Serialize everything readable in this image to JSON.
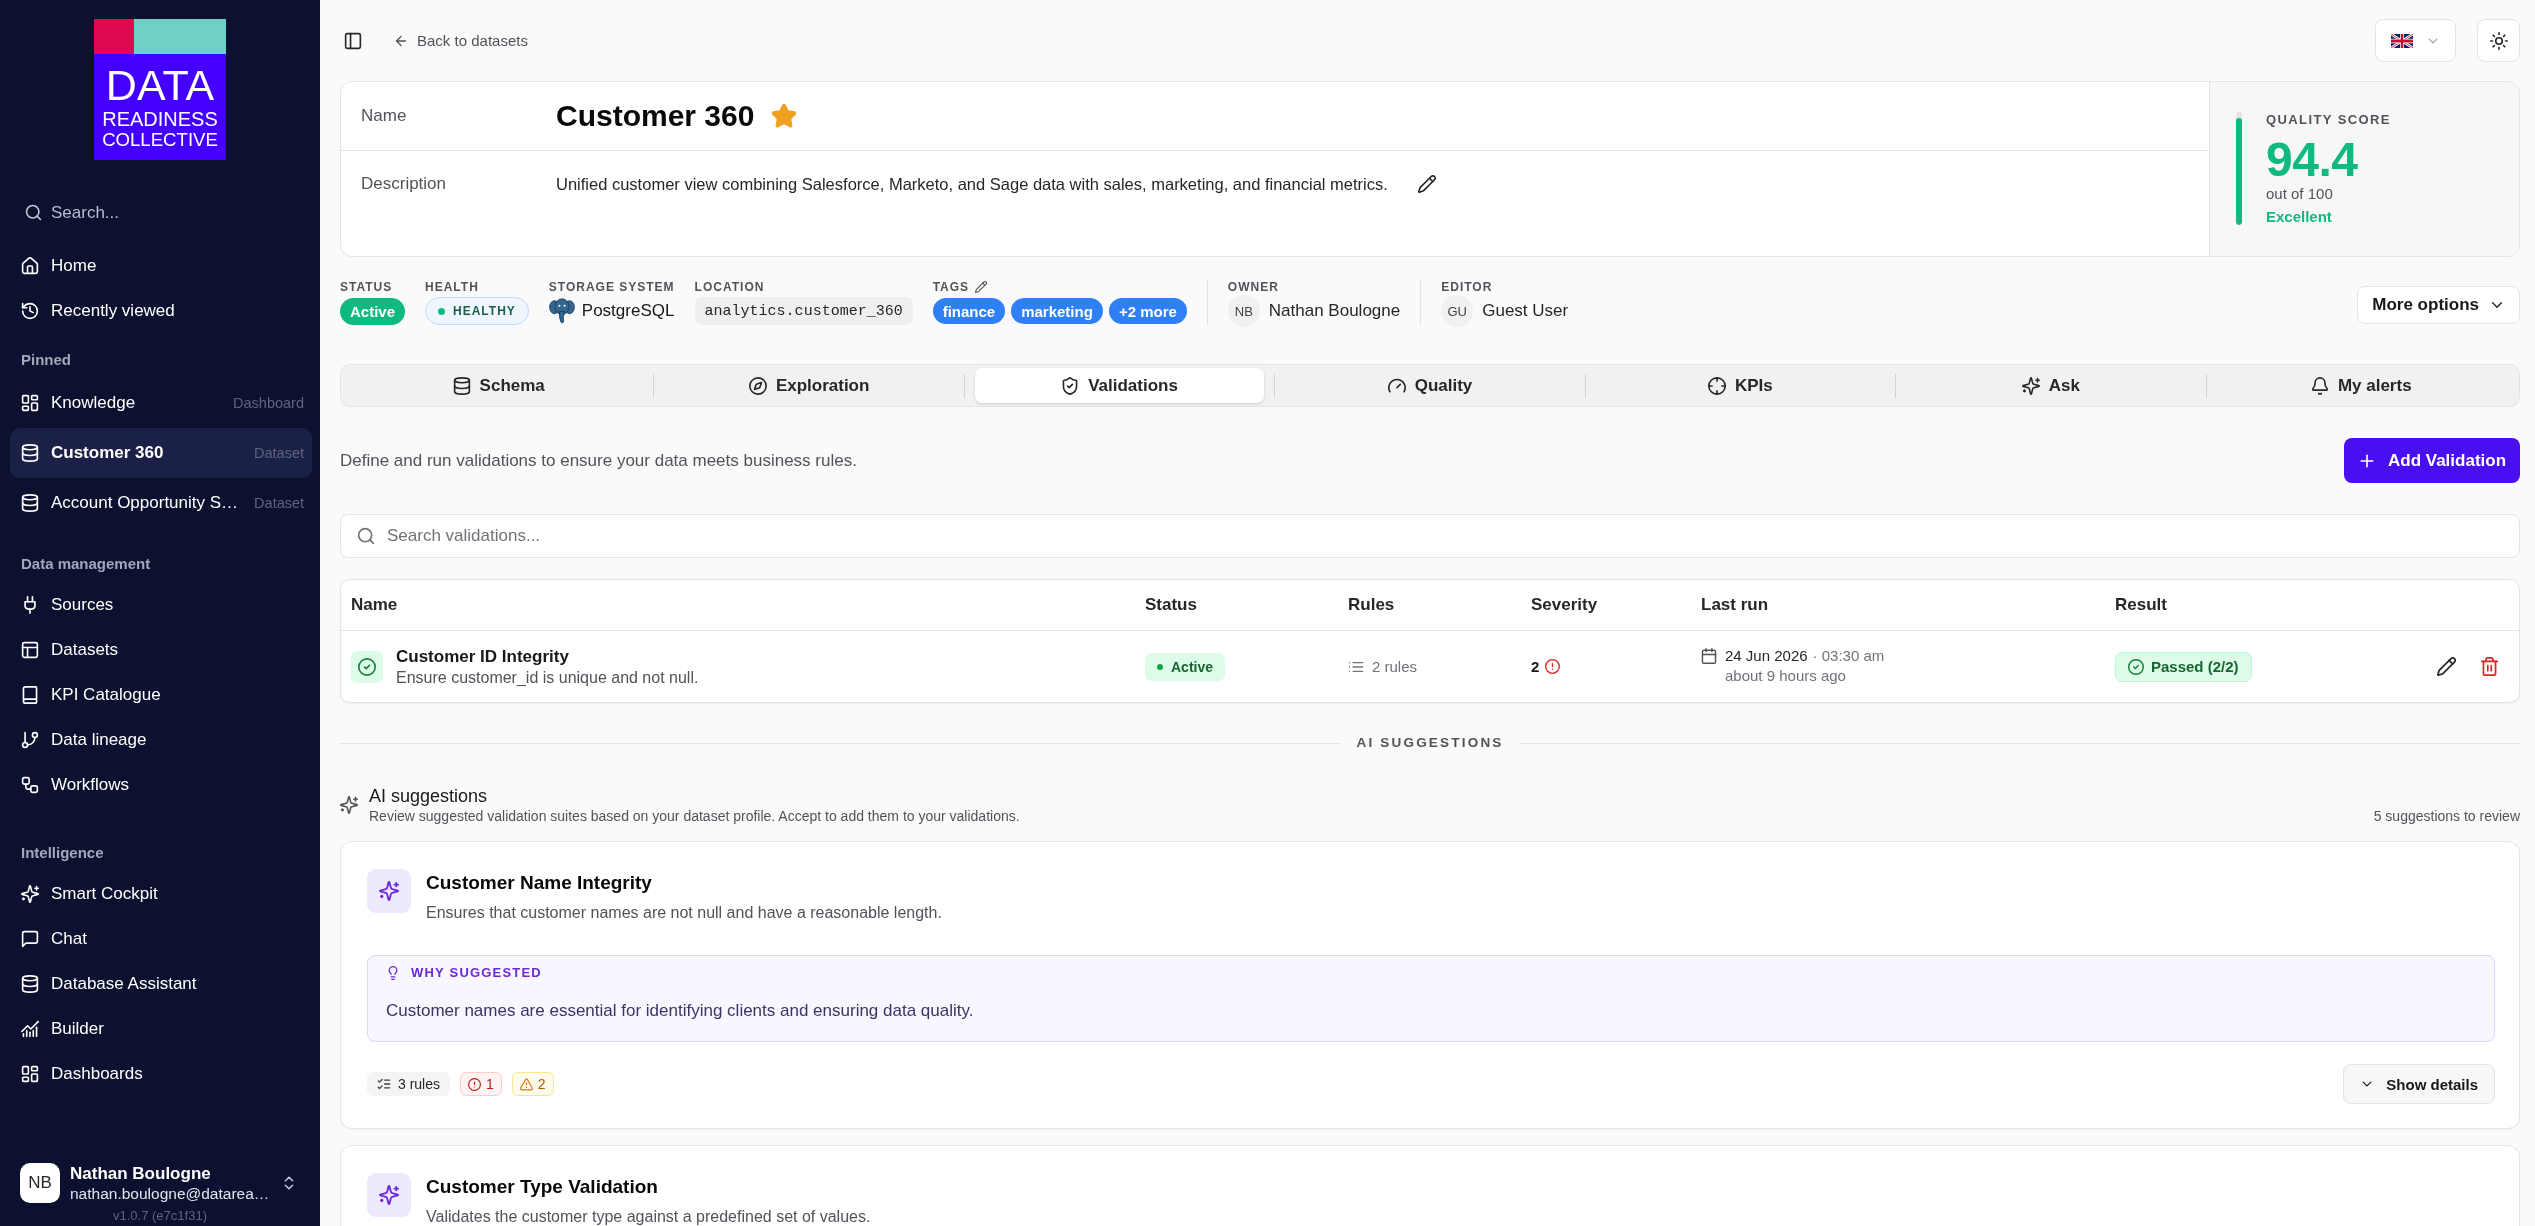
{
  "sidebar": {
    "logo": [
      "DATA",
      "READINESS",
      "COLLECTIVE"
    ],
    "search": {
      "placeholder": "Search..."
    },
    "sections": [
      {
        "items": [
          {
            "label": "Home",
            "selected": false
          },
          {
            "label": "Recently viewed",
            "selected": false
          }
        ]
      },
      {
        "title": "Pinned",
        "items": [
          {
            "label": "Knowledge",
            "category": "Dashboard",
            "selected": false
          },
          {
            "label": "Customer 360",
            "category": "Dataset",
            "selected": true
          },
          {
            "label": "Account Opportunity S…",
            "category": "Dataset",
            "selected": false
          }
        ]
      },
      {
        "title": "Data management",
        "items": [
          {
            "label": "Sources",
            "selected": false
          },
          {
            "label": "Datasets",
            "selected": false
          },
          {
            "label": "KPI Catalogue",
            "selected": false
          },
          {
            "label": "Data lineage",
            "selected": false
          },
          {
            "label": "Workflows",
            "selected": false
          }
        ]
      },
      {
        "title": "Intelligence",
        "items": [
          {
            "label": "Smart Cockpit",
            "selected": false
          },
          {
            "label": "Chat",
            "selected": false
          },
          {
            "label": "Database Assistant",
            "selected": false
          },
          {
            "label": "Builder",
            "selected": false
          },
          {
            "label": "Dashboards",
            "selected": false
          }
        ]
      }
    ],
    "user": {
      "initials": "NB",
      "name": "Nathan Boulogne",
      "email": "nathan.boulogne@datarea…"
    },
    "version": "v1.0.7 (e7c1f31)"
  },
  "toolbar": {
    "back_link": "Back to datasets"
  },
  "dataset": {
    "name_label": "Name",
    "name": "Customer 360",
    "favorite": true,
    "description_label": "Description",
    "description": "Unified customer view combining Salesforce, Marketo, and Sage data with sales, marketing, and financial metrics."
  },
  "quality_score": {
    "title": "QUALITY SCORE",
    "value": "94.4",
    "scale": "out of 100",
    "rating": "Excellent",
    "level": 0.944
  },
  "meta": {
    "status": {
      "label": "STATUS",
      "value": "Active"
    },
    "health": {
      "label": "HEALTH",
      "value": "HEALTHY"
    },
    "storage": {
      "label": "STORAGE SYSTEM",
      "value": "PostgreSQL"
    },
    "location": {
      "label": "LOCATION",
      "value": "analytics.customer_360"
    },
    "tags": {
      "label": "TAGS",
      "items": [
        "finance",
        "marketing",
        "+2 more"
      ]
    },
    "owner": {
      "label": "OWNER",
      "initials": "NB",
      "name": "Nathan Boulogne"
    },
    "editor": {
      "label": "EDITOR",
      "initials": "GU",
      "name": "Guest User"
    },
    "more_button": "More options"
  },
  "tabs": [
    {
      "label": "Schema",
      "selected": false
    },
    {
      "label": "Exploration",
      "selected": false
    },
    {
      "label": "Validations",
      "selected": true
    },
    {
      "label": "Quality",
      "selected": false
    },
    {
      "label": "KPIs",
      "selected": false
    },
    {
      "label": "Ask",
      "selected": false
    },
    {
      "label": "My alerts",
      "selected": false
    }
  ],
  "validations": {
    "intro": "Define and run validations to ensure your data meets business rules.",
    "add_button": "Add Validation",
    "search": {
      "placeholder": "Search validations..."
    },
    "table": {
      "columns": [
        "Name",
        "Status",
        "Rules",
        "Severity",
        "Last run",
        "Result"
      ],
      "rows": [
        {
          "name": "Customer ID Integrity",
          "description": "Ensure customer_id is unique and not null.",
          "status": "Active",
          "rules": "2 rules",
          "severity": "2",
          "last_run": {
            "date": "24 Jun 2026",
            "time": "· 03:30 am",
            "relative": "about 9 hours ago"
          },
          "result": "Passed (2/2)"
        }
      ]
    }
  },
  "ai_suggestions": {
    "divider": "AI SUGGESTIONS",
    "title": "AI suggestions",
    "subtitle": "Review suggested validation suites based on your dataset profile. Accept to add them to your validations.",
    "count": "5 suggestions to review",
    "items": [
      {
        "title": "Customer Name Integrity",
        "description": "Ensures that customer names are not null and have a reasonable length.",
        "why_label": "WHY SUGGESTED",
        "why": "Customer names are essential for identifying clients and ensuring data quality.",
        "rules": "3 rules",
        "errors": "1",
        "warnings": "2",
        "details_button": "Show details"
      },
      {
        "title": "Customer Type Validation",
        "description": "Validates the customer type against a predefined set of values."
      }
    ]
  }
}
